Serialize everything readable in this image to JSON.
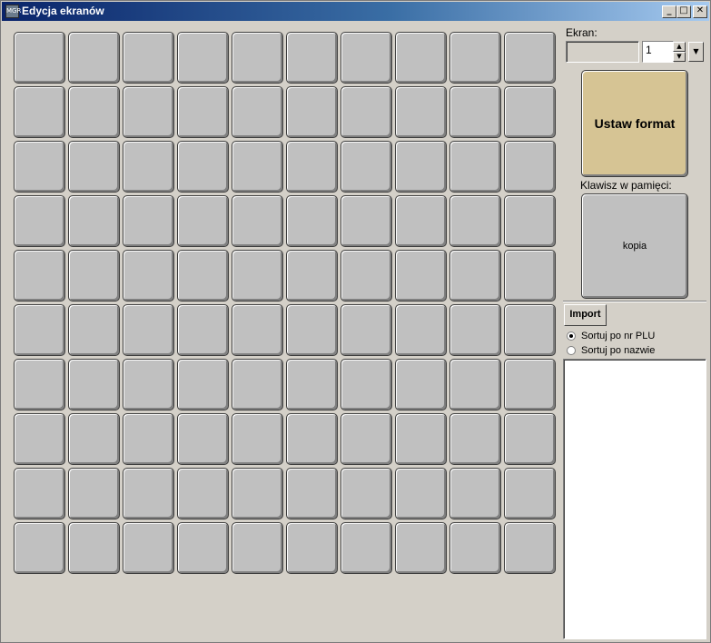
{
  "window": {
    "title": "Edycja ekranów",
    "app_icon_text": "MGR",
    "minimize_glyph": "_",
    "maximize_glyph": "□",
    "close_glyph": "✕"
  },
  "grid": {
    "rows": 10,
    "columns": 10,
    "key_color": "#c0c0c0"
  },
  "panel": {
    "screen_label": "Ekran:",
    "screen_name_value": "",
    "screen_number_value": "1",
    "spin_up_glyph": "▲",
    "spin_down_glyph": "▼",
    "dropdown_glyph": "▼",
    "format_button_label": "Ustaw format",
    "format_button_color": "#d6c494",
    "memory_label": "Klawisz w pamięci:",
    "memory_key_label": "kopia",
    "import_label": "Import",
    "sort_options": [
      {
        "label": "Sortuj po nr PLU",
        "checked": true
      },
      {
        "label": "Sortuj po nazwie",
        "checked": false
      }
    ],
    "list_items": []
  }
}
